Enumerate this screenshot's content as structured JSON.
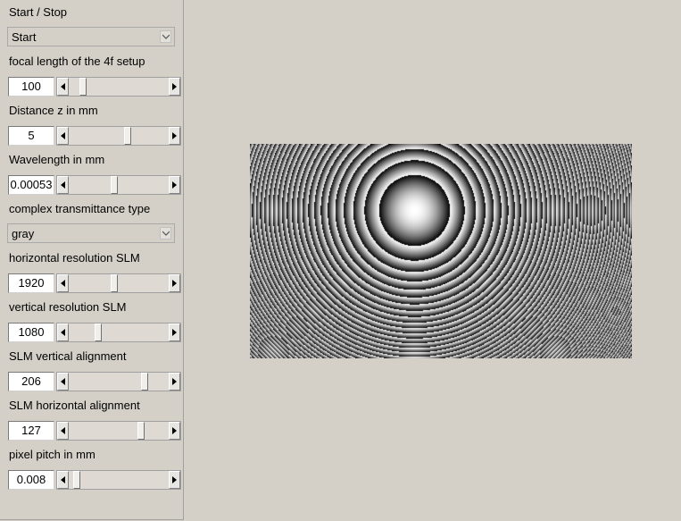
{
  "panel": {
    "start_stop": {
      "label": "Start / Stop",
      "selected": "Start"
    },
    "focal_length": {
      "label": "focal length of the 4f setup",
      "value": "100",
      "level": 0.12
    },
    "distance_z": {
      "label": "Distance z in mm",
      "value": "5",
      "level": 0.6
    },
    "wavelength": {
      "label": "Wavelength in mm",
      "value": "0.00053",
      "level": 0.45
    },
    "transmittance_type": {
      "label": "complex transmittance type",
      "selected": "gray"
    },
    "hres": {
      "label": "horizontal resolution SLM",
      "value": "1920",
      "level": 0.45
    },
    "vres": {
      "label": "vertical resolution SLM",
      "value": "1080",
      "level": 0.28
    },
    "valign": {
      "label": "SLM vertical alignment",
      "value": "206",
      "level": 0.78
    },
    "halign": {
      "label": "SLM horizontal alignment",
      "value": "127",
      "level": 0.74
    },
    "pixel_pitch": {
      "label": "pixel pitch in mm",
      "value": "0.008",
      "level": 0.05
    }
  },
  "icons": {
    "combo_arrow": "chevron-down-icon",
    "slider_left": "triangle-left-icon",
    "slider_right": "triangle-right-icon"
  },
  "colors": {
    "background": "#d4d0c8",
    "hologram_light": "#ffffff",
    "hologram_dark": "#000000"
  }
}
